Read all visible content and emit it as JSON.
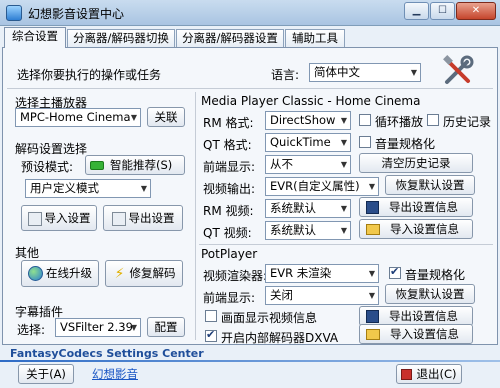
{
  "window": {
    "title": "幻想影音设置中心"
  },
  "tabs": [
    "综合设置",
    "分离器/解码器切换",
    "分离器/解码器设置",
    "辅助工具"
  ],
  "header": {
    "prompt": "选择你要执行的操作或任务",
    "language_label": "语言:",
    "language_value": "简体中文"
  },
  "player": {
    "section": "选择主播放器",
    "value": "MPC-Home Cinema",
    "associate_button": "关联"
  },
  "decode": {
    "section": "解码设置选择",
    "preset_label": "预设模式:",
    "smart_button": "智能推荐(S)",
    "mode_value": "用户定义模式",
    "import_button": "导入设置",
    "export_button": "导出设置"
  },
  "other": {
    "section": "其他",
    "upgrade_button": "在线升级",
    "repair_button": "修复解码"
  },
  "subtitle": {
    "section": "字幕插件",
    "select_label": "选择:",
    "value": "VSFilter 2.39",
    "config_button": "配置"
  },
  "mpc": {
    "section": "Media Player Classic - Home Cinema",
    "rm_format_label": "RM 格式:",
    "rm_format_value": "DirectShow",
    "loop_label": "循环播放",
    "history_label": "历史记录",
    "qt_format_label": "QT 格式:",
    "qt_format_value": "QuickTime",
    "normalize_label": "音量规格化",
    "front_label": "前端显示:",
    "front_value": "从不",
    "clear_history_button": "清空历史记录",
    "video_out_label": "视频输出:",
    "video_out_value": "EVR(自定义属性)",
    "restore_button": "恢复默认设置",
    "rm_video_label": "RM 视频:",
    "rm_video_value": "系统默认",
    "export_info_button": "导出设置信息",
    "qt_video_label": "QT 视频:",
    "qt_video_value": "系统默认",
    "import_info_button": "导入设置信息"
  },
  "potplayer": {
    "section": "PotPlayer",
    "renderer_label": "视频渲染器:",
    "renderer_value": "EVR 未渲染",
    "normalize_label": "音量规格化",
    "front_label": "前端显示:",
    "front_value": "关闭",
    "restore_button": "恢复默认设置",
    "osd_label": "画面显示视频信息",
    "export_info_button": "导出设置信息",
    "dxva_label": "开启内部解码器DXVA",
    "import_info_button": "导入设置信息"
  },
  "footer": {
    "brand": "FantasyCodecs Settings Center",
    "about_button": "关于(A)",
    "link": "幻想影音",
    "exit_button": "退出(C)"
  },
  "colors": {
    "accent": "#1f4e9a",
    "link": "#1a56c4",
    "smart_led": "#36b236"
  }
}
